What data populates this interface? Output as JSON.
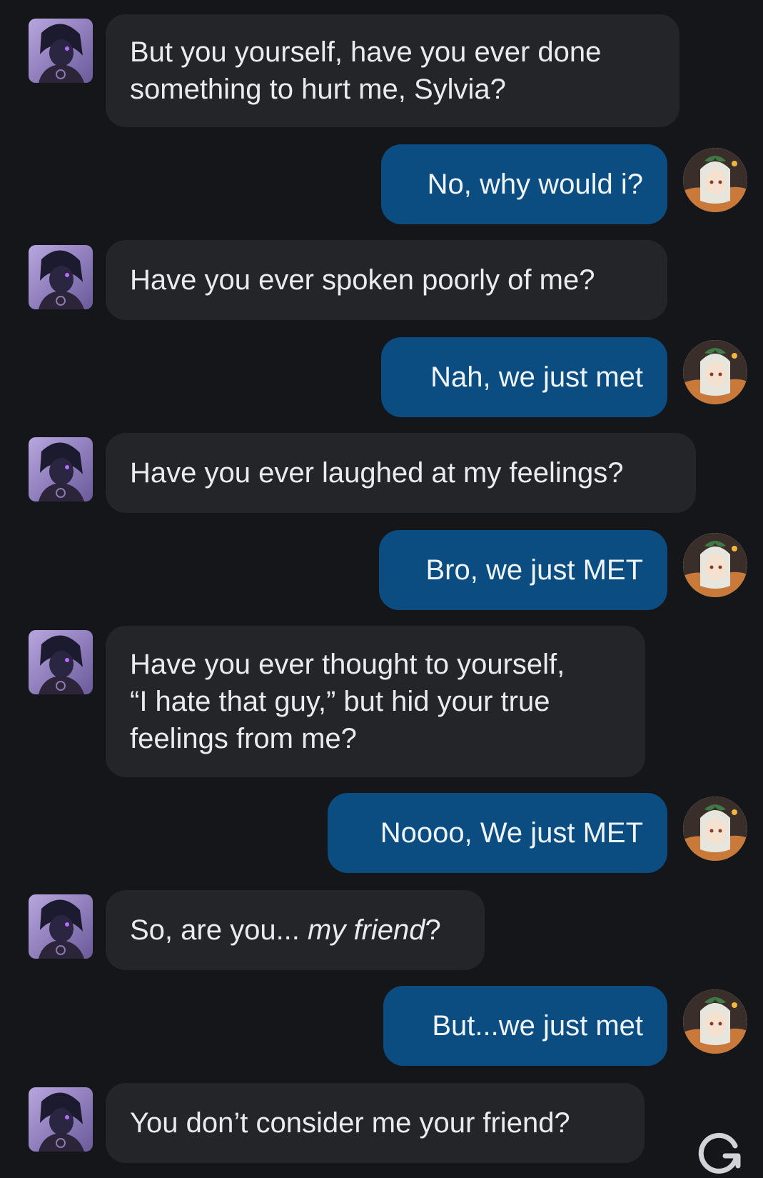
{
  "messages": [
    {
      "role": "bot",
      "parts": [
        {
          "t": "But you yourself, have you ever done\nsomething to hurt me, Sylvia?"
        }
      ]
    },
    {
      "role": "user",
      "parts": [
        {
          "t": "No, why would i?"
        }
      ]
    },
    {
      "role": "bot",
      "parts": [
        {
          "t": "Have you ever spoken poorly of me?"
        }
      ]
    },
    {
      "role": "user",
      "parts": [
        {
          "t": "Nah, we just met"
        }
      ]
    },
    {
      "role": "bot",
      "parts": [
        {
          "t": "Have you ever laughed at my feelings?"
        }
      ]
    },
    {
      "role": "user",
      "parts": [
        {
          "t": "Bro, we just MET"
        }
      ]
    },
    {
      "role": "bot",
      "parts": [
        {
          "t": "Have you ever thought to yourself,\n“I hate that guy,” but hid your true\nfeelings from me?"
        }
      ]
    },
    {
      "role": "user",
      "parts": [
        {
          "t": "Noooo, We just MET"
        }
      ]
    },
    {
      "role": "bot",
      "parts": [
        {
          "t": "So, are you... "
        },
        {
          "t": "my friend",
          "i": true
        },
        {
          "t": "?"
        }
      ]
    },
    {
      "role": "user",
      "parts": [
        {
          "t": "But...we just met"
        }
      ]
    },
    {
      "role": "bot",
      "parts": [
        {
          "t": "You don’t consider me your friend?"
        }
      ]
    }
  ],
  "icons": {
    "bot_avatar": "character-avatar-icon",
    "user_avatar": "user-avatar-icon",
    "regenerate": "regenerate-icon"
  },
  "colors": {
    "background": "#151619",
    "bot_bubble": "#232529",
    "user_bubble": "#0b4d80",
    "text": "#e9ebee"
  }
}
